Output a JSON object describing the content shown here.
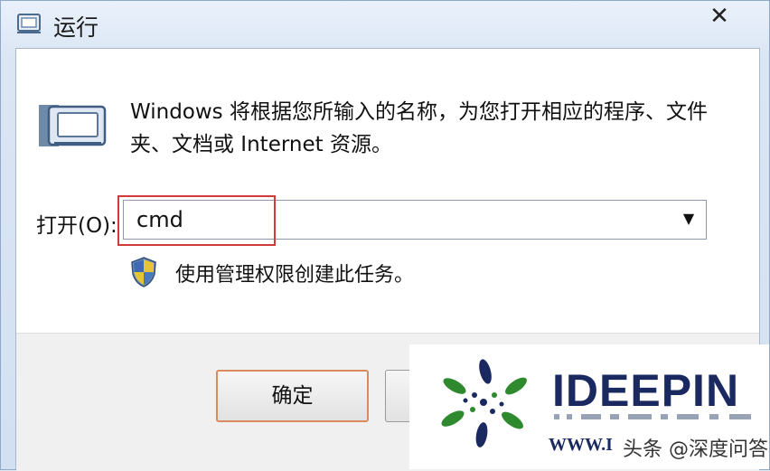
{
  "window": {
    "title": "运行",
    "close_glyph": "✕"
  },
  "content": {
    "description": "Windows 将根据您所输入的名称，为您打开相应的程序、文件夹、文档或 Internet 资源。",
    "open_label": "打开(O):",
    "command_value": "cmd",
    "admin_note": "使用管理权限创建此任务。"
  },
  "buttons": {
    "ok_label": "确定"
  },
  "watermark": {
    "brand": "IDEEPIN",
    "url": "WWW.I",
    "source": "头条 @深度问答",
    "brand_color": "#1a2a60"
  },
  "icons": {
    "app": "run-dialog-icon",
    "shield": "uac-shield-icon",
    "dropdown": "chevron-down-icon"
  }
}
